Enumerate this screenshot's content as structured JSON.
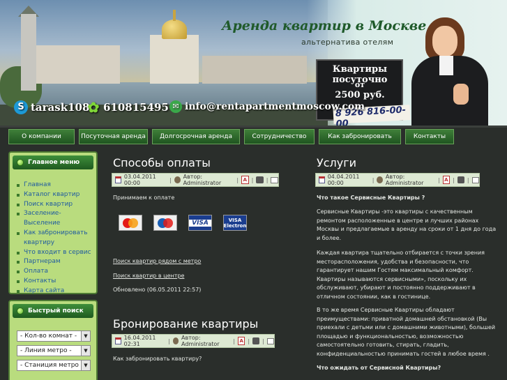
{
  "header": {
    "title": "Аренда квартир в Москве",
    "subtitle": "альтернатива отелям",
    "sign": {
      "line1": "Квартиры посуточно",
      "line2": "от",
      "line3": "2500 руб."
    },
    "phone": "8 926 816-00-00",
    "contacts": {
      "skype": "tarask108",
      "icq": "610815495",
      "email": "info@rentapartmentmoscow.com"
    }
  },
  "nav": [
    "О компании",
    "Посуточная аренда",
    "Долгосрочная аренда",
    "Сотрудничество",
    "Как забронировать",
    "Контакты"
  ],
  "sidebar": {
    "menu_title": "Главное меню",
    "menu_items": [
      "Главная",
      "Каталог квартир",
      "Поиск квартир",
      "Заселение-Выселение",
      "Как забронировать квартиру",
      "Что входит в сервис",
      "Партнерам",
      "Оплата",
      "Контакты",
      "Карта сайта"
    ],
    "search_title": "Быстрый поиск",
    "selects": [
      "- Кол-во комнат -",
      "- Линия метро -",
      "- Станиция метро -"
    ]
  },
  "left_col": {
    "article1": {
      "title": "Способы оплаты",
      "date": "03.04.2011 00:00",
      "author": "Автор: Administrator",
      "intro": "Принимаем к оплате",
      "cards": [
        "Mastercard",
        "Maestro",
        "VISA",
        "VISA Electron"
      ],
      "link1": "Поиск квартир рядом с метро",
      "link2": "Поиск квартир в центре",
      "updated": "Обновлено (06.05.2011 22:57)"
    },
    "article2": {
      "title": "Бронирование квартиры",
      "date": "16.04.2011 02:31",
      "author": "Автор: Administrator",
      "intro": "Как забронировать квартиру?"
    }
  },
  "right_col": {
    "title": "Услуги",
    "date": "04.04.2011 00:00",
    "author": "Автор: Administrator",
    "q1": "Что такое Сервисные Квартиры ?",
    "p1": [
      "Сервисные Квартиры   -это квартиры с качественным",
      "ремонтом расположенные в центре и лучших  районах",
      "Москвы и предлагаемые в аренду на сроки от 1 дня до года",
      "и более."
    ],
    "p2": [
      "Каждая квартира тщательно отбирается с точки зрения",
      "месторасположения, удобства и безопасности, что",
      "гарантирует нашим Гостям максимальный комфорт.",
      "Квартиры называются   сервисными», поскольку их",
      "обслуживают, убирают и постоянно поддерживают в",
      "отличном состоянии, как в гостинице."
    ],
    "p3": [
      "В то же время Сервисные Квартиры обладают",
      "преимуществами:  приватной домашней обстановкой  (Вы",
      "приехали с детьми или  с домашними животными), большей",
      "площадью и функциональностью, возможностью",
      "самостоятельно готовить, стирать, гладить,",
      "конфиденциальностью принимать гостей  в любое время  ."
    ],
    "q2": "Что ожидать от Сервисной Квартиры?"
  },
  "colors": {
    "accent_green": "#1f5420",
    "sidebar_bg": "#b9dc7e",
    "page_bg": "#2a2e2b",
    "link": "#1f5aa0"
  }
}
